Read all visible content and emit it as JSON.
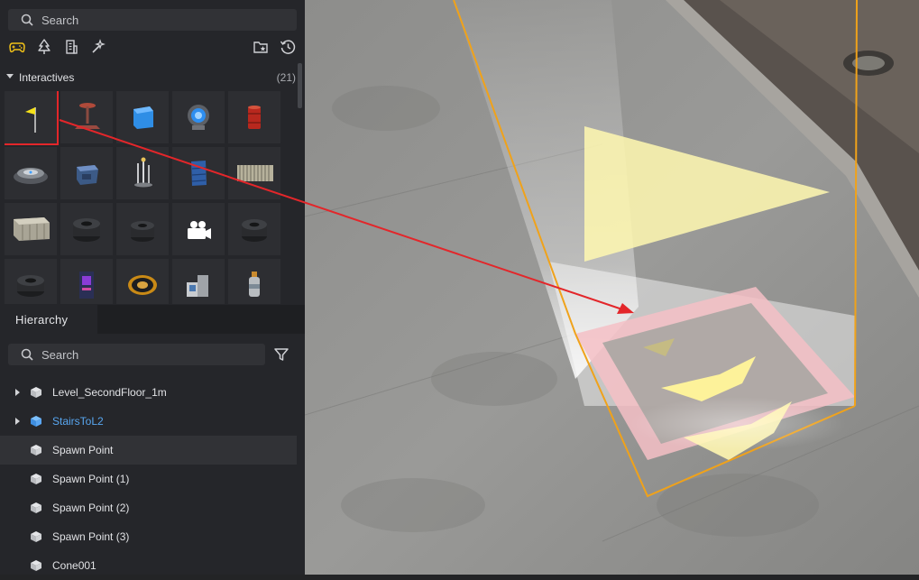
{
  "asset_browser": {
    "search_placeholder": "Search",
    "category_tabs": [
      {
        "name": "gamepad-icon",
        "active": true
      },
      {
        "name": "tree-icon",
        "active": false
      },
      {
        "name": "building-icon",
        "active": false
      },
      {
        "name": "magic-wand-icon",
        "active": false
      }
    ],
    "toolbar_right": [
      "folder-star-icon",
      "history-icon"
    ],
    "section": {
      "title": "Interactives",
      "count": "(21)"
    },
    "grid": [
      [
        "yellow-flag",
        "spawn-pad-stand",
        "blue-cube",
        "teleport-portal",
        "red-barrel"
      ],
      [
        "round-pad",
        "crate-blue",
        "lamp-cluster",
        "blue-cabinet",
        "fence-segment"
      ],
      [
        "shipping-container",
        "tire-stack",
        "tire-stack",
        "camera-icon",
        "tire-stack"
      ],
      [
        "tire-stack",
        "arcade-machine",
        "gold-coin-pad",
        "water-dispenser",
        "gas-canister"
      ]
    ],
    "selected_tile": "yellow-flag"
  },
  "hierarchy": {
    "tab_label": "Hierarchy",
    "search_placeholder": "Search",
    "items": [
      {
        "label": "Level_SecondFloor_1m",
        "expandable": true,
        "blue": false,
        "highlighted": false
      },
      {
        "label": "StairsToL2",
        "expandable": true,
        "blue": true,
        "highlighted": false
      },
      {
        "label": "Spawn Point",
        "expandable": false,
        "blue": false,
        "highlighted": true
      },
      {
        "label": "Spawn Point (1)",
        "expandable": false,
        "blue": false,
        "highlighted": false
      },
      {
        "label": "Spawn Point (2)",
        "expandable": false,
        "blue": false,
        "highlighted": false
      },
      {
        "label": "Spawn Point (3)",
        "expandable": false,
        "blue": false,
        "highlighted": false
      },
      {
        "label": "Cone001",
        "expandable": false,
        "blue": false,
        "highlighted": false
      }
    ]
  },
  "colors": {
    "panel_bg": "#25262a",
    "search_bg": "#313236",
    "accent_blue": "#58a6f0",
    "highlight_red": "#e3262a",
    "selection_orange": "#f0a21a",
    "flag_yellow": "#f6e21a"
  }
}
